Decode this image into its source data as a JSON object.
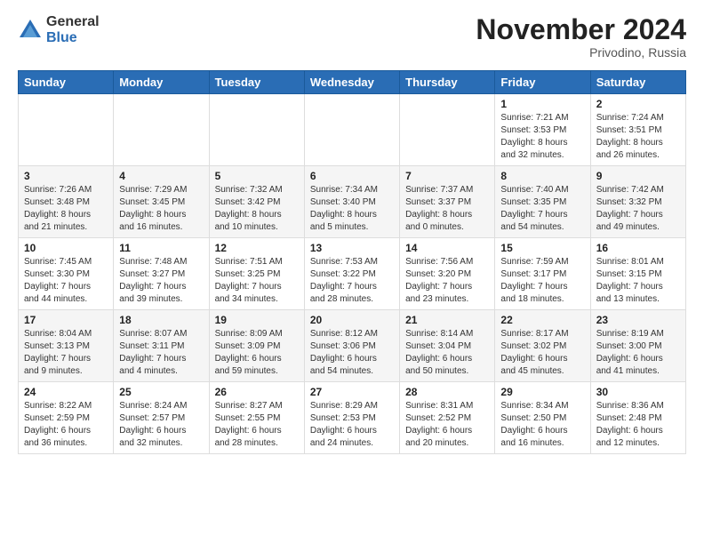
{
  "header": {
    "logo_general": "General",
    "logo_blue": "Blue",
    "month_title": "November 2024",
    "location": "Privodino, Russia"
  },
  "days_of_week": [
    "Sunday",
    "Monday",
    "Tuesday",
    "Wednesday",
    "Thursday",
    "Friday",
    "Saturday"
  ],
  "weeks": [
    [
      {
        "day": "",
        "info": ""
      },
      {
        "day": "",
        "info": ""
      },
      {
        "day": "",
        "info": ""
      },
      {
        "day": "",
        "info": ""
      },
      {
        "day": "",
        "info": ""
      },
      {
        "day": "1",
        "info": "Sunrise: 7:21 AM\nSunset: 3:53 PM\nDaylight: 8 hours\nand 32 minutes."
      },
      {
        "day": "2",
        "info": "Sunrise: 7:24 AM\nSunset: 3:51 PM\nDaylight: 8 hours\nand 26 minutes."
      }
    ],
    [
      {
        "day": "3",
        "info": "Sunrise: 7:26 AM\nSunset: 3:48 PM\nDaylight: 8 hours\nand 21 minutes."
      },
      {
        "day": "4",
        "info": "Sunrise: 7:29 AM\nSunset: 3:45 PM\nDaylight: 8 hours\nand 16 minutes."
      },
      {
        "day": "5",
        "info": "Sunrise: 7:32 AM\nSunset: 3:42 PM\nDaylight: 8 hours\nand 10 minutes."
      },
      {
        "day": "6",
        "info": "Sunrise: 7:34 AM\nSunset: 3:40 PM\nDaylight: 8 hours\nand 5 minutes."
      },
      {
        "day": "7",
        "info": "Sunrise: 7:37 AM\nSunset: 3:37 PM\nDaylight: 8 hours\nand 0 minutes."
      },
      {
        "day": "8",
        "info": "Sunrise: 7:40 AM\nSunset: 3:35 PM\nDaylight: 7 hours\nand 54 minutes."
      },
      {
        "day": "9",
        "info": "Sunrise: 7:42 AM\nSunset: 3:32 PM\nDaylight: 7 hours\nand 49 minutes."
      }
    ],
    [
      {
        "day": "10",
        "info": "Sunrise: 7:45 AM\nSunset: 3:30 PM\nDaylight: 7 hours\nand 44 minutes."
      },
      {
        "day": "11",
        "info": "Sunrise: 7:48 AM\nSunset: 3:27 PM\nDaylight: 7 hours\nand 39 minutes."
      },
      {
        "day": "12",
        "info": "Sunrise: 7:51 AM\nSunset: 3:25 PM\nDaylight: 7 hours\nand 34 minutes."
      },
      {
        "day": "13",
        "info": "Sunrise: 7:53 AM\nSunset: 3:22 PM\nDaylight: 7 hours\nand 28 minutes."
      },
      {
        "day": "14",
        "info": "Sunrise: 7:56 AM\nSunset: 3:20 PM\nDaylight: 7 hours\nand 23 minutes."
      },
      {
        "day": "15",
        "info": "Sunrise: 7:59 AM\nSunset: 3:17 PM\nDaylight: 7 hours\nand 18 minutes."
      },
      {
        "day": "16",
        "info": "Sunrise: 8:01 AM\nSunset: 3:15 PM\nDaylight: 7 hours\nand 13 minutes."
      }
    ],
    [
      {
        "day": "17",
        "info": "Sunrise: 8:04 AM\nSunset: 3:13 PM\nDaylight: 7 hours\nand 9 minutes."
      },
      {
        "day": "18",
        "info": "Sunrise: 8:07 AM\nSunset: 3:11 PM\nDaylight: 7 hours\nand 4 minutes."
      },
      {
        "day": "19",
        "info": "Sunrise: 8:09 AM\nSunset: 3:09 PM\nDaylight: 6 hours\nand 59 minutes."
      },
      {
        "day": "20",
        "info": "Sunrise: 8:12 AM\nSunset: 3:06 PM\nDaylight: 6 hours\nand 54 minutes."
      },
      {
        "day": "21",
        "info": "Sunrise: 8:14 AM\nSunset: 3:04 PM\nDaylight: 6 hours\nand 50 minutes."
      },
      {
        "day": "22",
        "info": "Sunrise: 8:17 AM\nSunset: 3:02 PM\nDaylight: 6 hours\nand 45 minutes."
      },
      {
        "day": "23",
        "info": "Sunrise: 8:19 AM\nSunset: 3:00 PM\nDaylight: 6 hours\nand 41 minutes."
      }
    ],
    [
      {
        "day": "24",
        "info": "Sunrise: 8:22 AM\nSunset: 2:59 PM\nDaylight: 6 hours\nand 36 minutes."
      },
      {
        "day": "25",
        "info": "Sunrise: 8:24 AM\nSunset: 2:57 PM\nDaylight: 6 hours\nand 32 minutes."
      },
      {
        "day": "26",
        "info": "Sunrise: 8:27 AM\nSunset: 2:55 PM\nDaylight: 6 hours\nand 28 minutes."
      },
      {
        "day": "27",
        "info": "Sunrise: 8:29 AM\nSunset: 2:53 PM\nDaylight: 6 hours\nand 24 minutes."
      },
      {
        "day": "28",
        "info": "Sunrise: 8:31 AM\nSunset: 2:52 PM\nDaylight: 6 hours\nand 20 minutes."
      },
      {
        "day": "29",
        "info": "Sunrise: 8:34 AM\nSunset: 2:50 PM\nDaylight: 6 hours\nand 16 minutes."
      },
      {
        "day": "30",
        "info": "Sunrise: 8:36 AM\nSunset: 2:48 PM\nDaylight: 6 hours\nand 12 minutes."
      }
    ]
  ]
}
